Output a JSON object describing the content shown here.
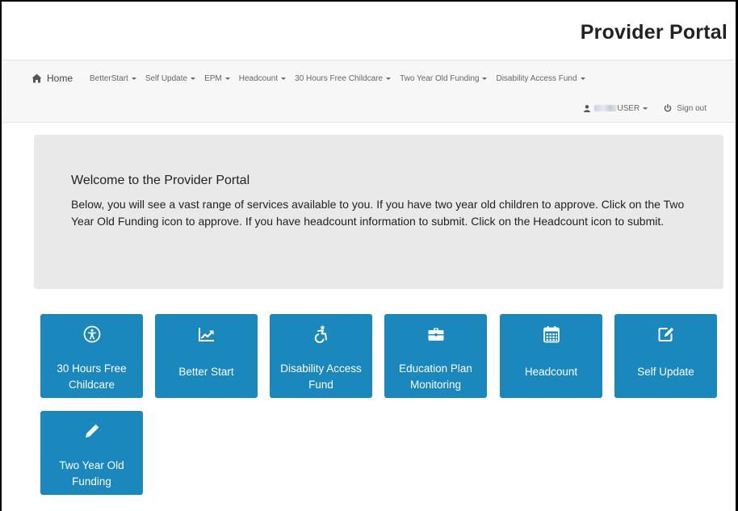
{
  "header": {
    "title": "Provider Portal"
  },
  "nav": {
    "home": "Home",
    "items": [
      {
        "label": "BetterStart"
      },
      {
        "label": "Self Update"
      },
      {
        "label": "EPM"
      },
      {
        "label": "Headcount"
      },
      {
        "label": "30 Hours Free Childcare"
      },
      {
        "label": "Two Year Old Funding"
      },
      {
        "label": "Disability Access Fund"
      }
    ],
    "user": "USER",
    "signout": "Sign out"
  },
  "welcome": {
    "title": "Welcome to the Provider Portal",
    "body": "Below, you will see a vast range of services available to you. If you have two year old children to approve. Click on the Two Year Old Funding icon to approve. If you have headcount information to submit. Click on the Headcount icon to submit."
  },
  "tiles": [
    {
      "label": "30 Hours Free Childcare",
      "icon": "accessibility-icon"
    },
    {
      "label": "Better Start",
      "icon": "line-chart-icon"
    },
    {
      "label": "Disability Access Fund",
      "icon": "wheelchair-icon"
    },
    {
      "label": "Education Plan Monitoring",
      "icon": "briefcase-icon"
    },
    {
      "label": "Headcount",
      "icon": "calendar-icon"
    },
    {
      "label": "Self Update",
      "icon": "edit-icon"
    },
    {
      "label": "Two Year Old Funding",
      "icon": "pencil-icon"
    }
  ],
  "colors": {
    "tile": "#1a87bd",
    "jumbotron": "#e9e9e9",
    "navbar": "#f7f7f7"
  }
}
